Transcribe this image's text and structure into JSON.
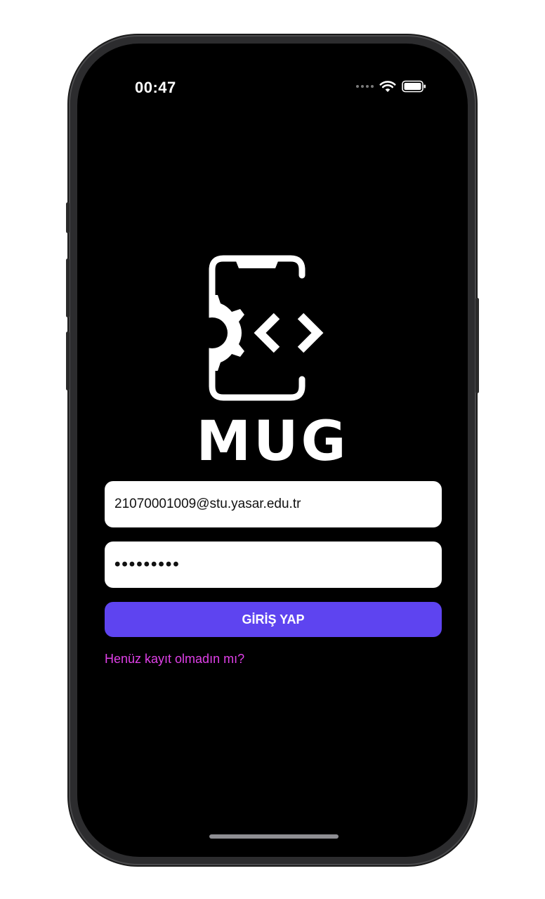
{
  "status_bar": {
    "time": "00:47",
    "wifi_icon": "wifi-icon",
    "battery_icon": "battery-icon"
  },
  "logo": {
    "icon": "mug-phone-gear-code-logo",
    "brand_text": "MUG"
  },
  "login_form": {
    "email_value": "21070001009@stu.yasar.edu.tr",
    "password_value": "123456789",
    "submit_label": "GİRİŞ YAP",
    "register_link": "Henüz kayıt olmadın mı?"
  },
  "colors": {
    "background": "#000000",
    "primary_button": "#5e44f0",
    "link": "#e040e8"
  }
}
